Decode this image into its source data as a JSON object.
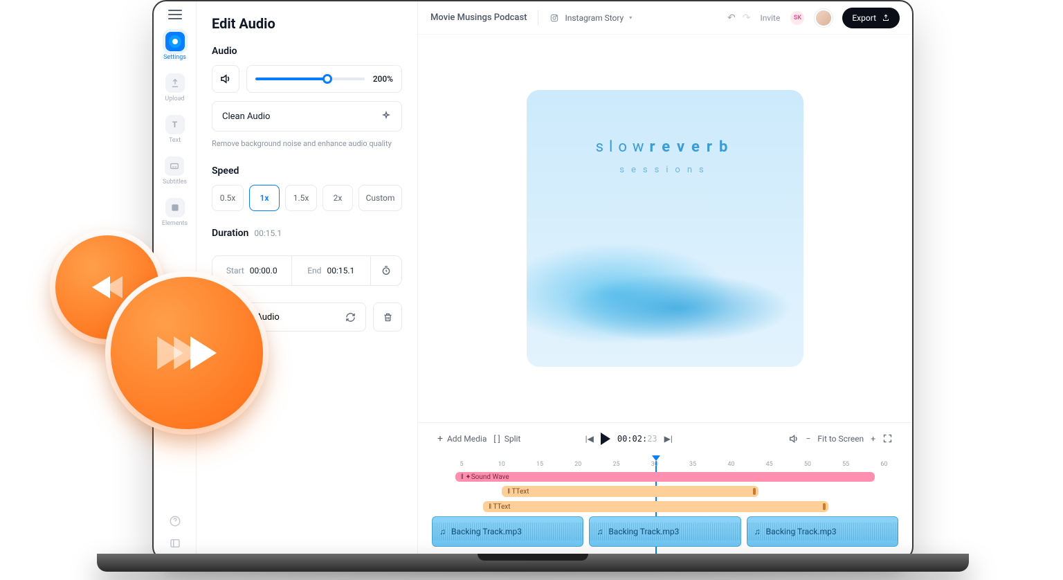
{
  "header": {
    "menu_icon": "hamburger-icon",
    "panel_title": "Edit Audio",
    "project_name": "Movie Musings Podcast",
    "format_label": "Instagram Story",
    "invite_label": "Invite",
    "avatar_initials": "SK",
    "export_label": "Export"
  },
  "rail": {
    "items": [
      {
        "key": "settings",
        "label": "Settings",
        "active": true
      },
      {
        "key": "upload",
        "label": "Upload",
        "active": false
      },
      {
        "key": "text",
        "label": "Text",
        "active": false
      },
      {
        "key": "subtitles",
        "label": "Subtitles",
        "active": false
      },
      {
        "key": "elements",
        "label": "Elements",
        "active": false
      }
    ]
  },
  "audio": {
    "section_label": "Audio",
    "volume_value": "200%",
    "clean_audio_label": "Clean Audio",
    "clean_audio_help": "Remove background noise and enhance audio quality"
  },
  "speed": {
    "section_label": "Speed",
    "options": [
      "0.5x",
      "1x",
      "1.5x",
      "2x",
      "Custom"
    ],
    "selected": "1x"
  },
  "duration": {
    "section_label": "Duration",
    "total": "00:15.1",
    "start_label": "Start",
    "start_value": "00:00.0",
    "end_label": "End",
    "end_value": "00:15.1"
  },
  "replace": {
    "label": "Replace Audio"
  },
  "artwork": {
    "title_light": "slow",
    "title_bold": "reverb",
    "subtitle": "sessions"
  },
  "controls": {
    "add_media": "Add Media",
    "split": "Split",
    "timecode_main": "00:02:",
    "timecode_ms": "23",
    "fit_label": "Fit to Screen"
  },
  "timeline": {
    "ticks": [
      "5",
      "10",
      "15",
      "20",
      "25",
      "30",
      "35",
      "40",
      "45",
      "50",
      "55",
      "60"
    ],
    "tracks": {
      "soundwave": "Sound Wave",
      "text_a": "Text",
      "text_b": "Text",
      "audio_clip": "Backing Track.mp3"
    },
    "clips_count": 3
  }
}
